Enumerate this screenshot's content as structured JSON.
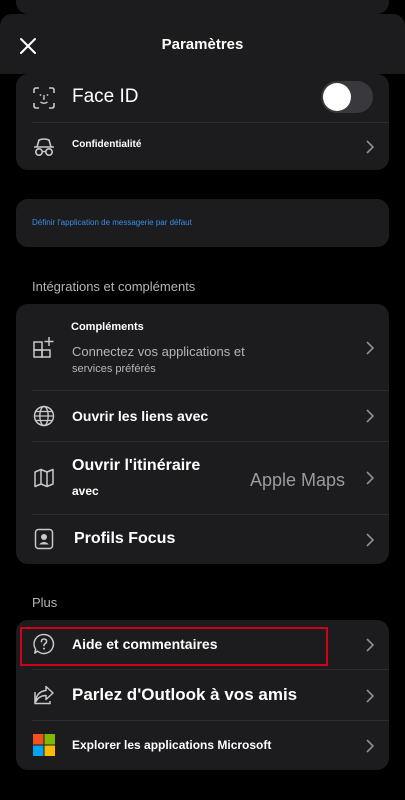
{
  "header": {
    "title": "Paramètres"
  },
  "account_card": {
    "face_id": {
      "label": "Face ID",
      "toggle_on": false
    },
    "privacy": {
      "label": "Confidentialité"
    }
  },
  "default_mail": {
    "link": "Définir l'application de messagerie par défaut",
    "color": "#3a8ee6"
  },
  "integrations": {
    "title": "Intégrations et compléments",
    "items": [
      {
        "label": "Compléments",
        "subtitle": "Connectez vos applications et",
        "subtitle2": "services préférés",
        "icon": "add-ins-icon"
      },
      {
        "label": "Ouvrir les liens avec",
        "icon": "globe-icon"
      },
      {
        "label": "Ouvrir l'itinéraire",
        "label2": "avec",
        "value": "Apple Maps",
        "icon": "map-icon"
      },
      {
        "label": "Profils Focus",
        "icon": "focus-profile-icon"
      }
    ]
  },
  "more": {
    "title": "Plus",
    "items": [
      {
        "label": "Aide et commentaires",
        "icon": "help-icon"
      },
      {
        "label": "Parlez d'Outlook à vos amis",
        "icon": "share-icon"
      },
      {
        "label": "Explorer les applications Microsoft",
        "icon": "microsoft-logo-icon"
      }
    ]
  },
  "colors": {
    "background": "#000000",
    "card": "#1c1c1e",
    "highlight": "#d0021b",
    "link": "#3a8ee6"
  }
}
